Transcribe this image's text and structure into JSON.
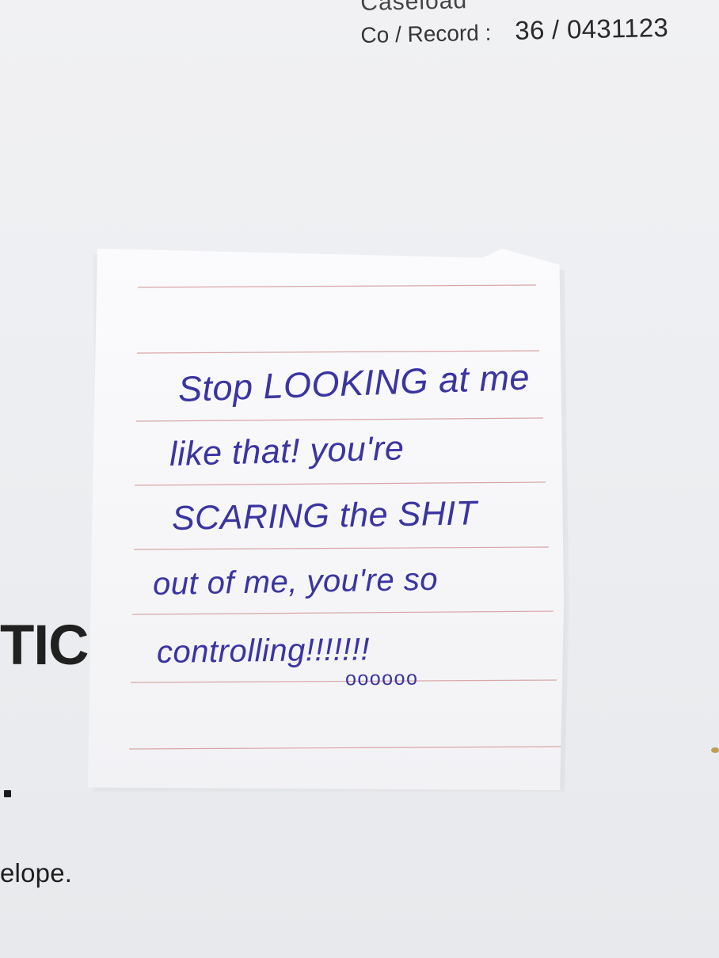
{
  "background_document": {
    "header_top_fragment": "Caseload",
    "record_label": "Co / Record :",
    "record_value": "36 / 0431123",
    "left_large_fragment": "TIC",
    "left_bottom_fragment": "elope."
  },
  "sticky_note": {
    "lines": [
      "Stop LOOKING at me",
      "like that! you're",
      "SCARING the SHIT",
      "out of me, you're so",
      "controlling!!!!!!!"
    ],
    "line_count_visible": 8
  },
  "colors": {
    "page_background": "#eceef1",
    "note_background": "#f7f7f9",
    "ink": "#3b35a1",
    "rule_lines": "#d8a6a6",
    "stain": "#b48d2c"
  }
}
